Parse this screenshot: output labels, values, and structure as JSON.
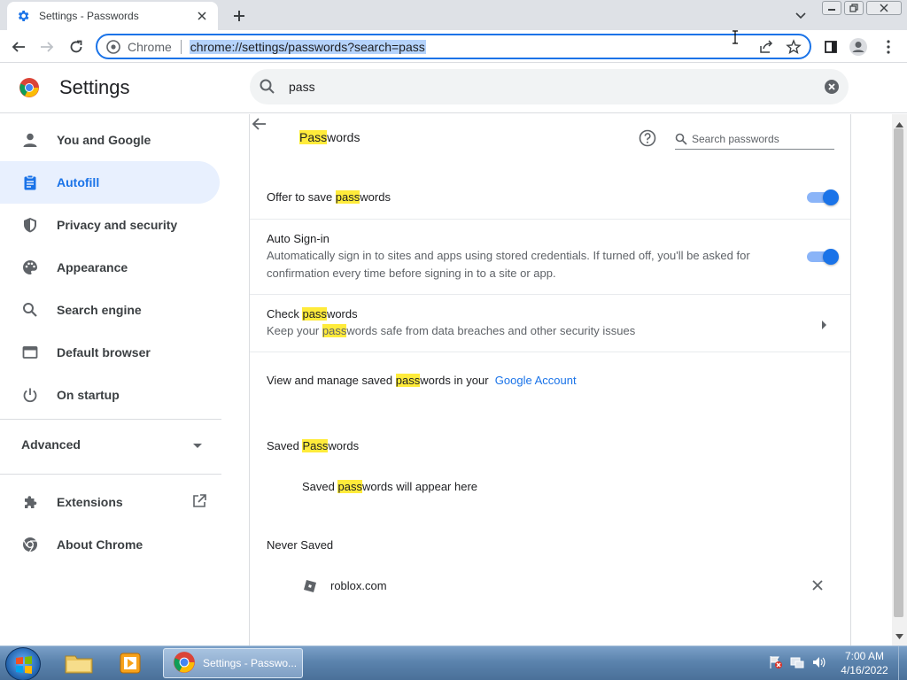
{
  "window": {
    "tab_title": "Settings - Passwords"
  },
  "toolbar": {
    "origin": "Chrome",
    "url": "chrome://settings/passwords?search=pass"
  },
  "header": {
    "title": "Settings",
    "search_value": "pass"
  },
  "sidebar": {
    "items": [
      {
        "label": "You and Google",
        "icon": "person-icon"
      },
      {
        "label": "Autofill",
        "icon": "clipboard-icon",
        "active": true
      },
      {
        "label": "Privacy and security",
        "icon": "shield-icon"
      },
      {
        "label": "Appearance",
        "icon": "palette-icon"
      },
      {
        "label": "Search engine",
        "icon": "search-icon"
      },
      {
        "label": "Default browser",
        "icon": "browser-icon"
      },
      {
        "label": "On startup",
        "icon": "power-icon"
      }
    ],
    "advanced_label": "Advanced",
    "extensions_label": "Extensions",
    "about_label": "About Chrome"
  },
  "passwords": {
    "title_hl": "Pass",
    "title_rest": "words",
    "search_placeholder": "Search passwords",
    "offer": {
      "pre": "Offer to save ",
      "hl": "pass",
      "post": "words",
      "enabled": true
    },
    "auto_signin": {
      "label": "Auto Sign-in",
      "desc_line1": "Automatically sign in to sites and apps using stored credentials. If turned off, you'll be asked for",
      "desc_line2": "confirmation every time before signing in to a site or app.",
      "enabled": true
    },
    "check": {
      "pre": "Check ",
      "hl": "pass",
      "post": "words",
      "desc_pre": "Keep your ",
      "desc_hl": "pass",
      "desc_post": "words safe from data breaches and other security issues"
    },
    "manage": {
      "pre": "View and manage saved ",
      "hl": "pass",
      "post": "words in your",
      "link": "Google Account"
    },
    "saved": {
      "heading_pre": "Saved ",
      "heading_hl": "Pass",
      "heading_post": "words",
      "empty_pre": "Saved ",
      "empty_hl": "pass",
      "empty_post": "words will appear here"
    },
    "never_saved": {
      "heading": "Never Saved",
      "sites": [
        "roblox.com"
      ]
    }
  },
  "taskbar": {
    "chrome_label": "Settings - Passwo...",
    "time": "7:00 AM",
    "date": "4/16/2022"
  },
  "colors": {
    "accent": "#1a73e8",
    "highlight": "#ffeb3b",
    "active_nav_bg": "#e8f0fe"
  }
}
